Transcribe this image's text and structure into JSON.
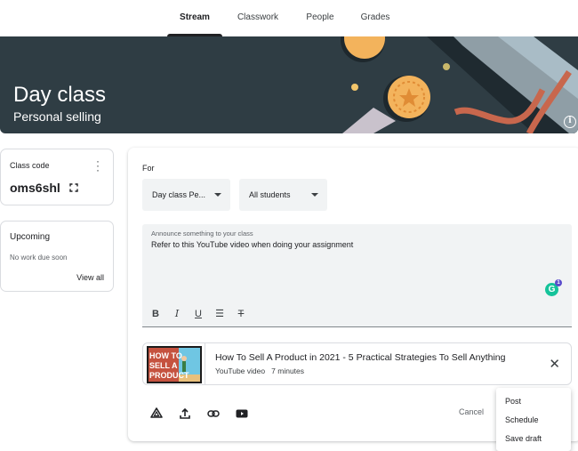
{
  "nav": {
    "tabs": [
      {
        "label": "Stream",
        "active": true
      },
      {
        "label": "Classwork",
        "active": false
      },
      {
        "label": "People",
        "active": false
      },
      {
        "label": "Grades",
        "active": false
      }
    ]
  },
  "banner": {
    "title": "Day class",
    "subtitle": "Personal selling",
    "info_icon": "info-icon",
    "colors": {
      "background": "#2f3d44",
      "medal": "#f3b35c",
      "ribbon": "#c8674d"
    }
  },
  "class_code": {
    "label": "Class code",
    "code": "oms6shl",
    "menu_icon": "more-vert-icon",
    "expand_icon": "fullscreen-icon"
  },
  "upcoming": {
    "label": "Upcoming",
    "empty_text": "No work due soon",
    "view_all": "View all"
  },
  "composer": {
    "for_label": "For",
    "class_select": "Day class Pe...",
    "audience_select": "All students",
    "placeholder": "Announce something to your class",
    "text": "Refer to this YouTube video when doing your assignment",
    "format_tools": [
      "bold-icon",
      "italic-icon",
      "underline-icon",
      "bulleted-list-icon",
      "clear-format-icon"
    ],
    "grammarly_badge": "1",
    "attachment": {
      "title": "How To Sell A Product in 2021 - 5 Practical Strategies To Sell Anything",
      "meta": "YouTube video   7 minutes",
      "thumb_text": [
        "HOW TO",
        "SELL A",
        "PRODUCT"
      ]
    },
    "attach_tools": [
      "google-drive-icon",
      "upload-icon",
      "link-icon",
      "youtube-icon"
    ],
    "cancel": "Cancel",
    "post_menu": [
      "Post",
      "Schedule",
      "Save draft"
    ]
  }
}
